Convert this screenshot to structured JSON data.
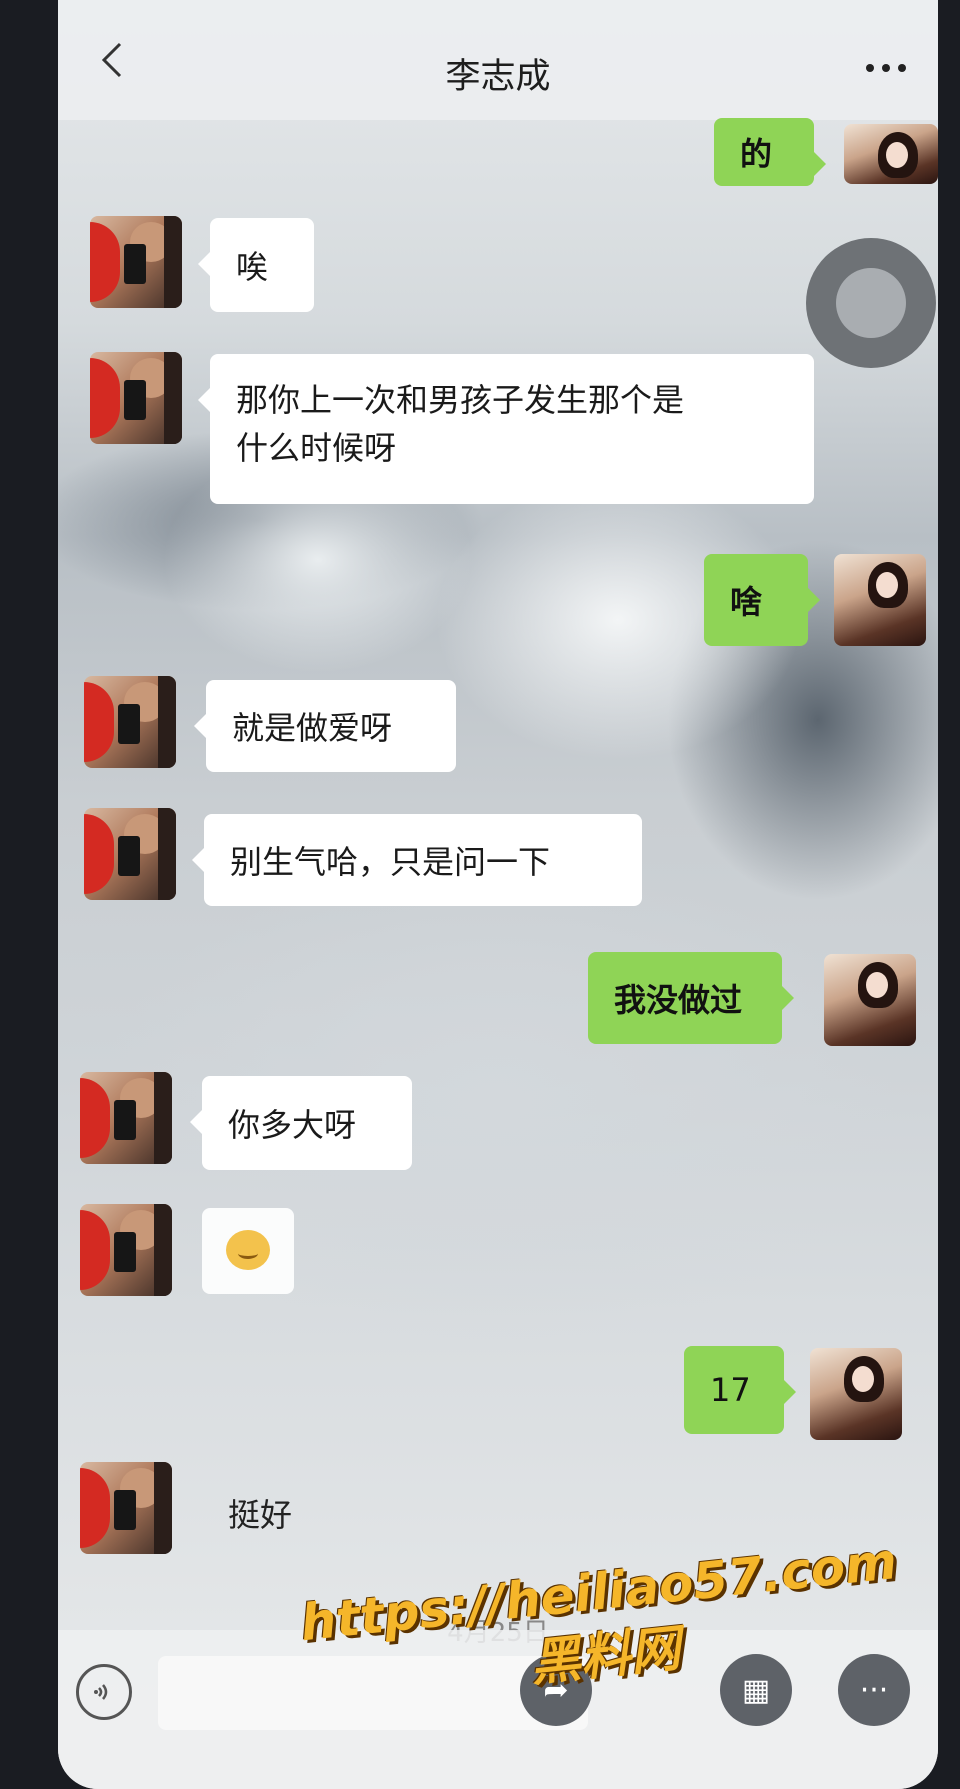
{
  "header": {
    "title": "李志成"
  },
  "messages": {
    "m0": "的",
    "m1": "唉",
    "m2_line1": "那你上一次和男孩子发生那个是",
    "m2_line2": "什么时候呀",
    "m3": "啥",
    "m4": "就是做爱呀",
    "m5": "别生气哈，只是问一下",
    "m6": "我没做过",
    "m7": "你多大呀",
    "m9": "17",
    "m10": "挺好"
  },
  "date_divider": "4月25日",
  "watermark": {
    "url": "https://heiliao57.com",
    "brand": "黑料网"
  },
  "colors": {
    "my_bubble": "#8fd456",
    "their_bubble": "#ffffff",
    "watermark": "#f5b62a"
  }
}
